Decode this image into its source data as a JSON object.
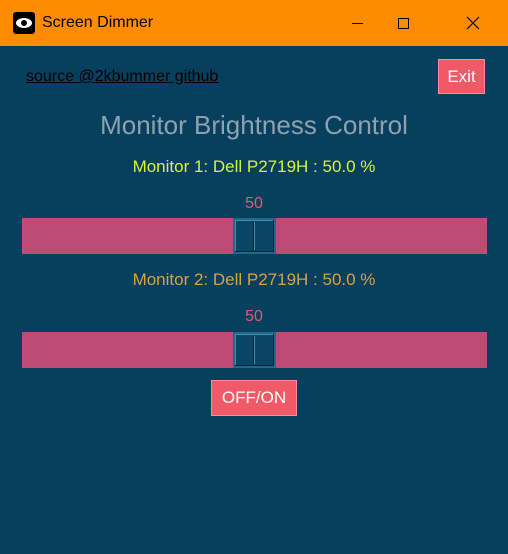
{
  "window": {
    "title": "Screen Dimmer",
    "icon": "eye-icon"
  },
  "header": {
    "source_link": "source @2kbummer github",
    "exit_label": "Exit",
    "title": "Monitor Brightness Control"
  },
  "monitors": [
    {
      "label": "Monitor 1: Dell P2719H : 50.0 %",
      "slider_value": "50",
      "level_percent": 50
    },
    {
      "label": "Monitor 2: Dell P2719H : 50.0 %",
      "slider_value": "50",
      "level_percent": 50
    }
  ],
  "controls": {
    "toggle_label": "OFF/ON"
  },
  "colors": {
    "titlebar": "#ff8c00",
    "background": "#073f5e",
    "button": "#f05a66",
    "slider_trough": "#bd4b73",
    "monitor1_text": "#d8f23c",
    "monitor2_text": "#d9a23a"
  }
}
